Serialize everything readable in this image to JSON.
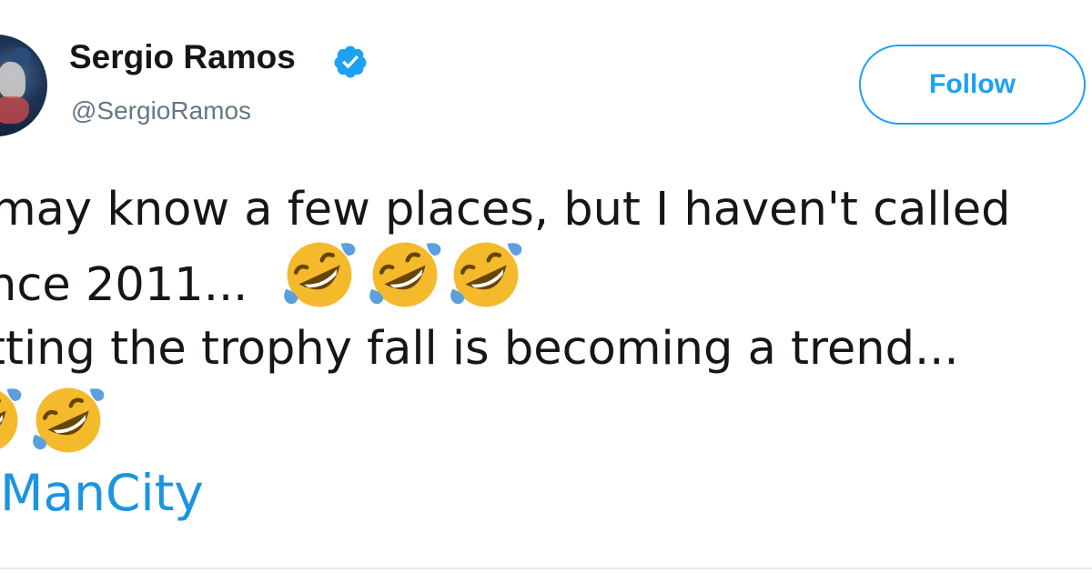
{
  "tweet": {
    "display_name": "Sergio Ramos",
    "handle": "@SergioRamos",
    "follow_label": "Follow",
    "text_line_1": "may know a few places, but I haven't called",
    "text_line_2": "nce 2011...",
    "text_line_3": "tting the trophy fall is becoming a trend...",
    "hashtag": "ManCity",
    "emoji_name": "rolling-on-the-floor-laughing"
  },
  "colors": {
    "accent": "#1da1f2",
    "hashtag": "#1b95e0",
    "text": "#14171a",
    "secondary_text": "#657786",
    "verified": "#1da1f2",
    "emoji_face": "#f5b92c",
    "emoji_tear": "#5aa0dc"
  }
}
